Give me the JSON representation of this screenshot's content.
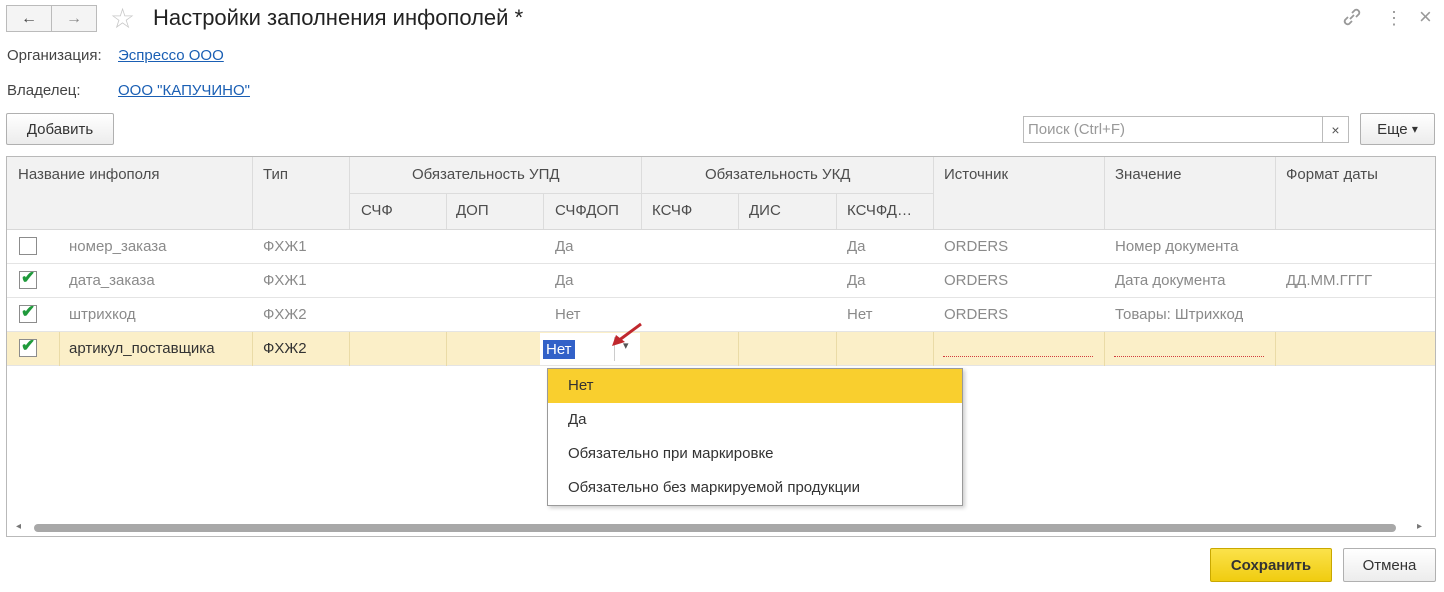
{
  "window": {
    "title": "Настройки заполнения инфополей *",
    "back_icon": "←",
    "forward_icon": "→",
    "star_icon": "☆",
    "link_icon": "🔗",
    "more_icon": "⋮",
    "close_icon": "×"
  },
  "form": {
    "org_label": "Организация:",
    "org_value": "Эспрессо ООО",
    "owner_label": "Владелец:",
    "owner_value": "ООО \"КАПУЧИНО\""
  },
  "toolbar": {
    "add_label": "Добавить",
    "search_placeholder": "Поиск (Ctrl+F)",
    "clear_icon": "×",
    "more_label": "Еще",
    "more_arrow": "▾"
  },
  "table": {
    "headers": {
      "name": "Название инфополя",
      "type": "Тип",
      "upd_group": "Обязательность УПД",
      "ukd_group": "Обязательность УКД",
      "source": "Источник",
      "value": "Значение",
      "date_format": "Формат даты",
      "schf": "СЧФ",
      "dop": "ДОП",
      "schfdop": "СЧФДОП",
      "kschf": "КСЧФ",
      "dis": "ДИС",
      "kschfdis": "КСЧФД…"
    },
    "rows": [
      {
        "checked": false,
        "name": "номер_заказа",
        "type": "ФХЖ1",
        "schfdop": "Да",
        "kschfdis": "Да",
        "source": "ORDERS",
        "value": "Номер документа",
        "date_format": ""
      },
      {
        "checked": true,
        "name": "дата_заказа",
        "type": "ФХЖ1",
        "schfdop": "Да",
        "kschfdis": "Да",
        "source": "ORDERS",
        "value": "Дата документа",
        "date_format": "ДД.ММ.ГГГГ"
      },
      {
        "checked": true,
        "name": "штрихкод",
        "type": "ФХЖ2",
        "schfdop": "Нет",
        "kschfdis": "Нет",
        "source": "ORDERS",
        "value": "Товары: Штрихкод",
        "date_format": ""
      },
      {
        "checked": true,
        "name": "артикул_поставщика",
        "type": "ФХЖ2",
        "schfdop": "Нет",
        "kschfdis": "",
        "source": "",
        "value": "",
        "date_format": ""
      }
    ],
    "check_mark": "✔"
  },
  "editor": {
    "current_value": "Нет",
    "dropdown_arrow": "▾",
    "options": [
      "Нет",
      "Да",
      "Обязательно при маркировке",
      "Обязательно без маркируемой продукции"
    ],
    "selected_index": 0
  },
  "scroll": {
    "left_arrow": "◂",
    "right_arrow": "▸"
  },
  "footer": {
    "save_label": "Сохранить",
    "cancel_label": "Отмена"
  },
  "colors": {
    "accent": "#f6d425",
    "selected_row": "#fbefc8",
    "link": "#1a5fb4",
    "check": "#1f9a3b",
    "highlight": "#3261c8"
  }
}
